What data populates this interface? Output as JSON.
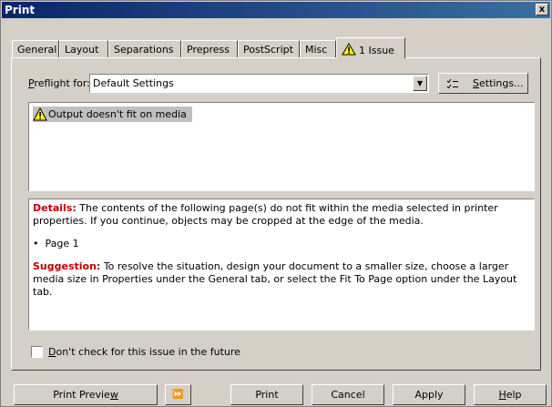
{
  "window": {
    "title": "Print",
    "close_glyph": "x"
  },
  "tabs": [
    {
      "label": "General"
    },
    {
      "label": "Layout"
    },
    {
      "label": "Separations"
    },
    {
      "label": "Prepress"
    },
    {
      "label": "PostScript"
    },
    {
      "label": "Misc"
    },
    {
      "label": "1 Issue",
      "icon": "warning-icon",
      "active": true
    }
  ],
  "preflight": {
    "label_first": "P",
    "label_rest": "reflight for:",
    "selected": "Default Settings",
    "settings_first": "S",
    "settings_rest": "ettings..."
  },
  "issues": [
    {
      "text": "Output doesn't fit on media",
      "icon": "warning-icon"
    }
  ],
  "details": {
    "details_heading": "Details:",
    "details_text": " The contents of the following page(s) do not fit within the media selected in printer properties. If you continue, objects may be cropped at the edge of the media.",
    "bullet": "•",
    "page_item": "Page 1",
    "suggestion_heading": "Suggestion:",
    "suggestion_text": " To resolve the situation, design your document to a smaller size, choose a larger media size in Properties under the General tab, or select the Fit To Page option under the Layout tab."
  },
  "checkbox": {
    "label_first": "D",
    "label_rest": "on't check for this issue in the future",
    "checked": false
  },
  "buttons": {
    "print_preview_main": "Print Previe",
    "print_preview_u": "w",
    "mini_preview_glyph": "⏩",
    "print": "Print",
    "cancel": "Cancel",
    "apply": "Apply",
    "help_first": "H",
    "help_rest": "elp"
  },
  "colors": {
    "title_start": "#0a246a",
    "title_end": "#3a6ea5",
    "details_red": "#c00000",
    "warning_yellow": "#ffff00"
  }
}
